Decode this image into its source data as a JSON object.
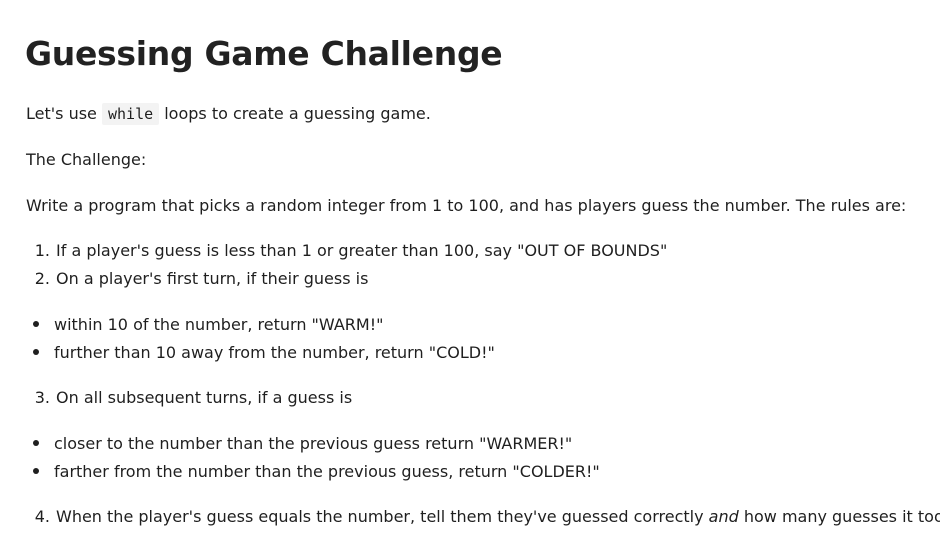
{
  "title": "Guessing Game Challenge",
  "intro": {
    "before": "Let's use ",
    "code": "while",
    "after": " loops to create a guessing game."
  },
  "challenge_label": "The Challenge:",
  "description": "Write a program that picks a random integer from 1 to 100, and has players guess the number. The rules are:",
  "rules": {
    "r1": {
      "marker": "1.",
      "text": "If a player's guess is less than 1 or greater than 100, say \"OUT OF BOUNDS\""
    },
    "r2": {
      "marker": "2.",
      "text": "On a player's first turn, if their guess is"
    },
    "r2_bullets": [
      "within 10 of the number, return \"WARM!\"",
      "further than 10 away from the number, return \"COLD!\""
    ],
    "r3": {
      "marker": "3.",
      "text": "On all subsequent turns, if a guess is"
    },
    "r3_bullets": [
      "closer to the number than the previous guess return \"WARMER!\"",
      "farther from the number than the previous guess, return \"COLDER!\""
    ],
    "r4": {
      "marker": "4.",
      "before": "When the player's guess equals the number, tell them they've guessed correctly ",
      "emph": "and",
      "after": " how many guesses it took!"
    }
  }
}
